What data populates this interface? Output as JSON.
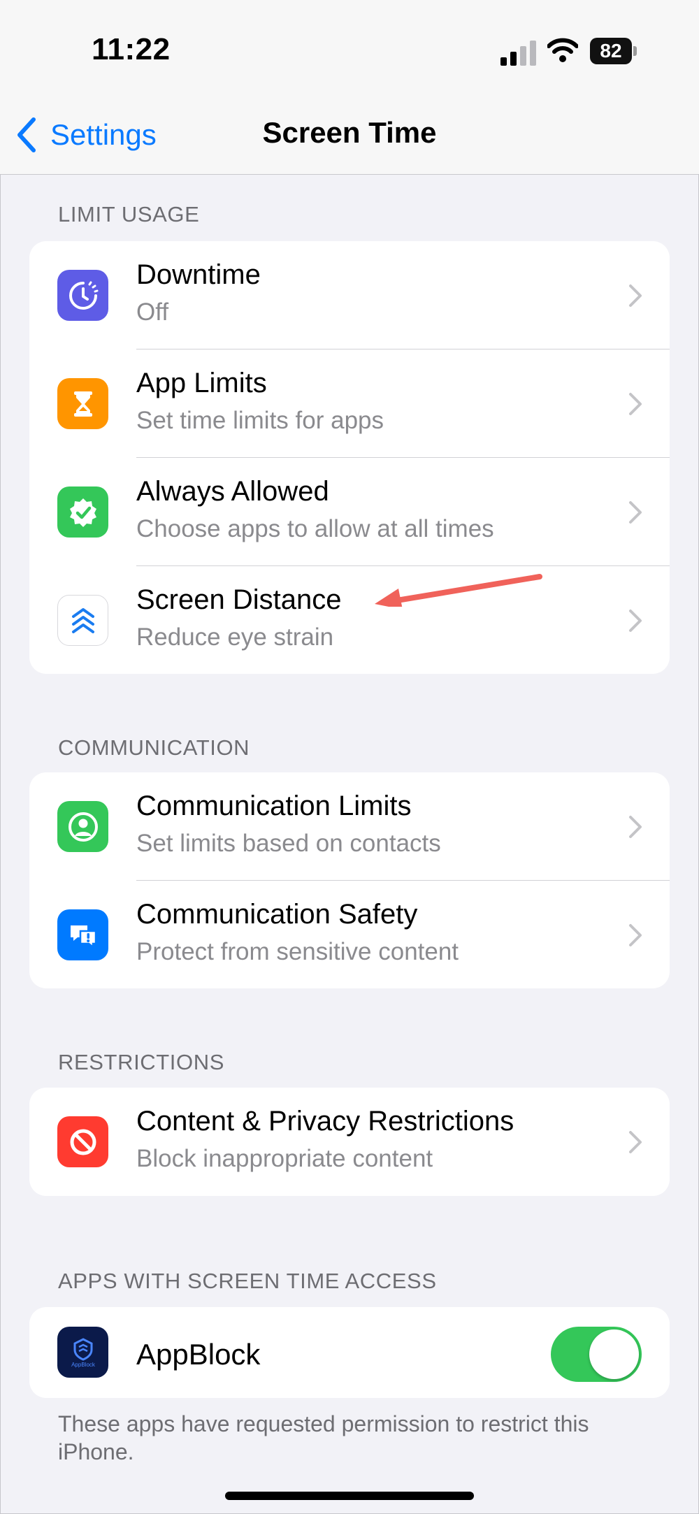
{
  "status_bar": {
    "time": "11:22",
    "battery": "82"
  },
  "nav": {
    "back_label": "Settings",
    "title": "Screen Time"
  },
  "limit_usage": {
    "header": "LIMIT USAGE",
    "items": [
      {
        "icon": "downtime-icon",
        "color": "#5e5ce6",
        "title": "Downtime",
        "subtitle": "Off"
      },
      {
        "icon": "hourglass-icon",
        "color": "#ff9500",
        "title": "App Limits",
        "subtitle": "Set time limits for apps"
      },
      {
        "icon": "checkmark-badge-icon",
        "color": "#34c759",
        "title": "Always Allowed",
        "subtitle": "Choose apps to allow at all times"
      },
      {
        "icon": "chevrons-up-icon",
        "color": "#ffffff",
        "title": "Screen Distance",
        "subtitle": "Reduce eye strain"
      }
    ]
  },
  "communication": {
    "header": "COMMUNICATION",
    "items": [
      {
        "icon": "person-circle-icon",
        "color": "#34c759",
        "title": "Communication Limits",
        "subtitle": "Set limits based on contacts"
      },
      {
        "icon": "chat-bubbles-icon",
        "color": "#007aff",
        "title": "Communication Safety",
        "subtitle": "Protect from sensitive content"
      }
    ]
  },
  "restrictions": {
    "header": "RESTRICTIONS",
    "items": [
      {
        "icon": "no-entry-icon",
        "color": "#ff3b30",
        "title": "Content & Privacy Restrictions",
        "subtitle": "Block inappropriate content"
      }
    ]
  },
  "apps_access": {
    "header": "APPS WITH SCREEN TIME ACCESS",
    "app": {
      "name": "AppBlock",
      "logo_text": "AppBlock",
      "enabled": true
    },
    "footer": "These apps have requested permission to restrict this iPhone."
  },
  "annotation": {
    "arrow_color": "#f0625a"
  }
}
